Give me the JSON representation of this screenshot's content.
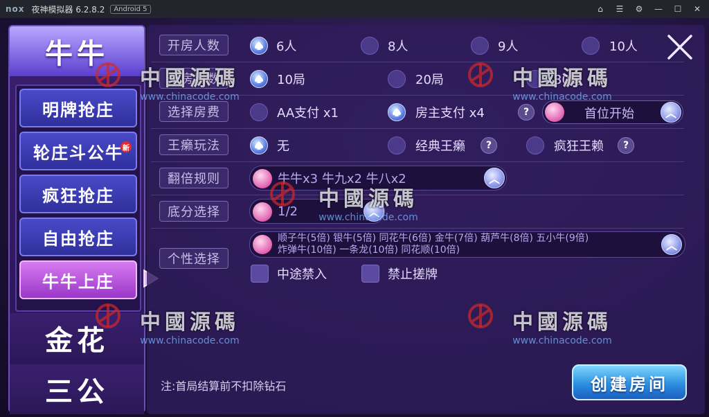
{
  "emulator": {
    "logo": "nox",
    "title": "夜神模拟器 6.2.8.2",
    "android_badge": "Android 5"
  },
  "sidebar": {
    "top_tab": "牛牛",
    "sub_items": [
      {
        "label": "明牌抢庄"
      },
      {
        "label": "轮庄斗公牛",
        "badge": "新"
      },
      {
        "label": "疯狂抢庄"
      },
      {
        "label": "自由抢庄"
      },
      {
        "label": "牛牛上庄",
        "active": true
      }
    ],
    "tab_jinhua": "金花",
    "tab_sangong": "三公"
  },
  "form": {
    "players": {
      "label": "开房人数",
      "options": [
        "6人",
        "8人",
        "9人",
        "10人"
      ],
      "selected": "6人"
    },
    "rounds": {
      "label": "开房局数",
      "options": [
        "10局",
        "20局",
        "30局"
      ],
      "selected": "10局"
    },
    "fee": {
      "label": "选择房费",
      "options": [
        "AA支付 x1",
        "房主支付 x4"
      ],
      "selected": "房主支付 x4",
      "help": "?"
    },
    "start_mode": {
      "value": "首位开始"
    },
    "wild": {
      "label": "王癞玩法",
      "options": [
        "无",
        "经典王癞",
        "疯狂王赖"
      ],
      "selected": "无",
      "help": "?"
    },
    "multiplier": {
      "label": "翻倍规则",
      "value": "牛牛x3 牛九x2 牛八x2"
    },
    "base": {
      "label": "底分选择",
      "value": "1/2"
    },
    "personal": {
      "label": "个性选择",
      "value_line1": "顺子牛(5倍)  银牛(5倍)  同花牛(6倍)  金牛(7倍)  葫芦牛(8倍)  五小牛(9倍)",
      "value_line2": "炸弹牛(10倍)  一条龙(10倍)  同花顺(10倍)",
      "checks": [
        "中途禁入",
        "禁止搓牌"
      ]
    }
  },
  "footer": {
    "note": "注:首局结算前不扣除钻石",
    "create_button": "创建房间"
  },
  "watermark": {
    "text": "中國源碼",
    "url": "www.chinacode.com"
  },
  "colors": {
    "accent_purple": "#5b3fd0",
    "active_pink": "#d77bf0",
    "create_blue": "#2b8fe0"
  }
}
